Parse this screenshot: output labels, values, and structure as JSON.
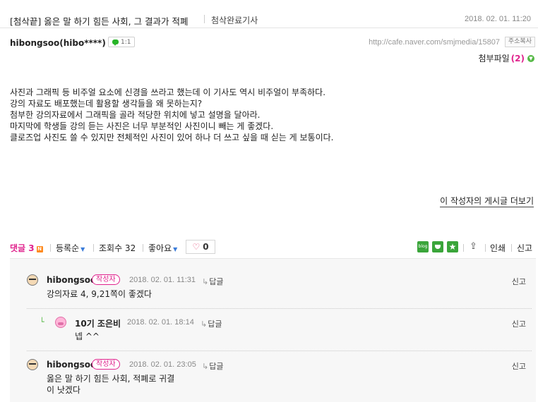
{
  "post": {
    "title": "[첨삭끝] 옳은 말 하기 힘든 사회, 그 결과가 적폐",
    "board": "첨삭완료기사",
    "date": "2018. 02. 01.   11:20",
    "author": "hibongsoo(hibo****)",
    "chat_count": "1:1",
    "url": "http://cafe.naver.com/smjmedia/15807",
    "copy_label": "주소복사",
    "attach_label": "첨부파일",
    "attach_count_text": "(2)",
    "body_lines": [
      "사진과 그래픽 등 비주얼 요소에 신경을 쓰라고 했는데 이 기사도 역시 비주얼이 부족하다.",
      "강의 자료도 배포했는데 활용할 생각들을 왜 못하는지?",
      "첨부한 강의자료에서 그래픽을 골라 적당한 위치에 넣고 설명을 달아라.",
      "마지막에 학생들 강의 듣는 사진은 너무 부분적인 사진이니 빼는 게 좋겠다.",
      "클로즈업 사진도 쓸 수 있지만 전체적인 사진이 있어 하나 더 쓰고 싶을 때 싣는 게 보통이다."
    ],
    "more_posts_label": "이 작성자의 게시글 더보기"
  },
  "actions": {
    "comment_label": "댓글 3",
    "new_badge": "N",
    "sort_label": "등록순",
    "views_label": "조회수 32",
    "likes_label": "좋아요",
    "like_count": "0",
    "blog_icon_text": "blog",
    "print_label": "인쇄",
    "report_label": "신고"
  },
  "comments": [
    {
      "nick": "hibongsoo",
      "badge": "작성자",
      "date": "2018. 02. 01.   11:31",
      "reply_label": "답글",
      "report_label": "신고",
      "lines": [
        "강의자료 4, 9,21쪽이 좋겠다"
      ]
    },
    {
      "nick": "10기 조은비",
      "date": "2018. 02. 01.   18:14",
      "reply_label": "답글",
      "report_label": "신고",
      "lines": [
        "넵 ^^"
      ]
    },
    {
      "nick": "hibongsoo",
      "badge": "작성자",
      "date": "2018. 02. 01.   23:05",
      "reply_label": "답글",
      "report_label": "신고",
      "lines": [
        "옳은 말 하기 힘든 사회, 적폐로 귀결",
        "이 낫겠다"
      ]
    }
  ],
  "colors": {
    "accent_pink": "#e0238d",
    "naver_green": "#3aa53a",
    "comment_bg": "#f7f7f7"
  }
}
